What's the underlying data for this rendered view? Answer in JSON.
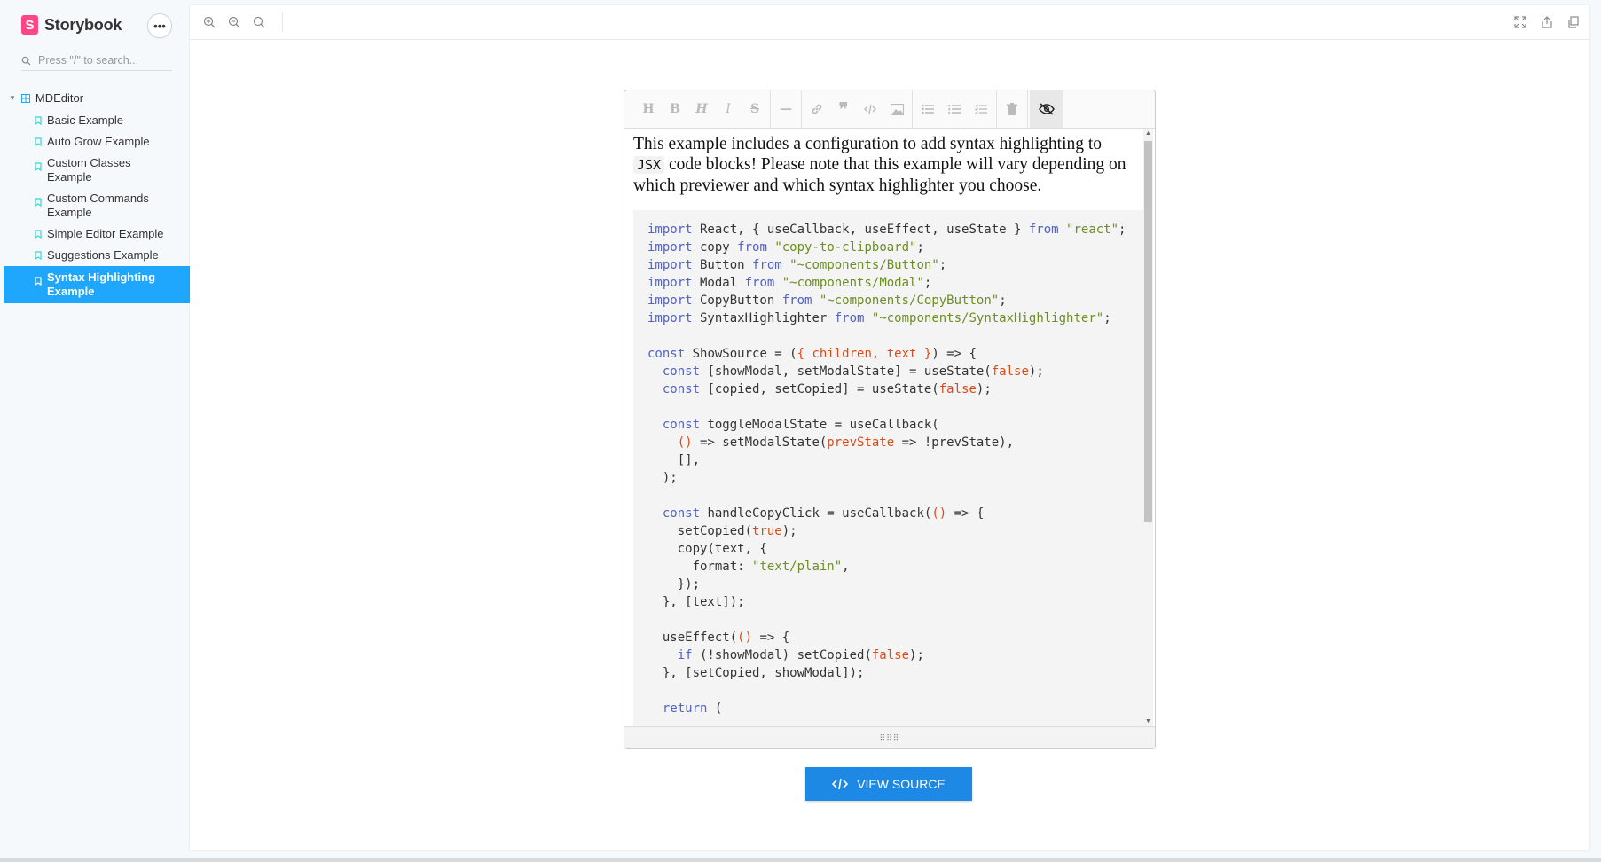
{
  "sidebar": {
    "brand": "Storybook",
    "brand_logo_letter": "S",
    "menu_icon": "ellipsis-icon",
    "search_placeholder": "Press \"/\" to search...",
    "root": "MDEditor",
    "items": [
      {
        "label": "Basic Example"
      },
      {
        "label": "Auto Grow Example"
      },
      {
        "label": "Custom Classes Example"
      },
      {
        "label": "Custom Commands Example"
      },
      {
        "label": "Simple Editor Example"
      },
      {
        "label": "Suggestions Example"
      },
      {
        "label": "Syntax Highlighting Example",
        "active": true
      }
    ]
  },
  "toolbar": {
    "left_icons": [
      "zoom-in-icon",
      "zoom-out-icon",
      "zoom-reset-icon"
    ],
    "right_icons": [
      "fullscreen-icon",
      "share-icon",
      "copy-link-icon"
    ]
  },
  "editor": {
    "toolbar_buttons": [
      "H",
      "B",
      "H",
      "I",
      "S",
      "—",
      "link",
      "quote",
      "code",
      "image",
      "ul",
      "ol",
      "checklist",
      "trash",
      "preview"
    ],
    "intro_before": "This example includes a configuration to add syntax highlighting to ",
    "intro_code": "JSX",
    "intro_after": " code blocks! Please note that this example will vary depending on which previewer and which syntax highlighter you choose."
  },
  "view_source_label": "VIEW SOURCE",
  "colors": {
    "accent": "#1ea7fd",
    "button": "#1e88e5",
    "brand": "#ff4785",
    "keyword": "#5263c2",
    "string": "#6c8e24",
    "literal": "#d84c1a"
  }
}
